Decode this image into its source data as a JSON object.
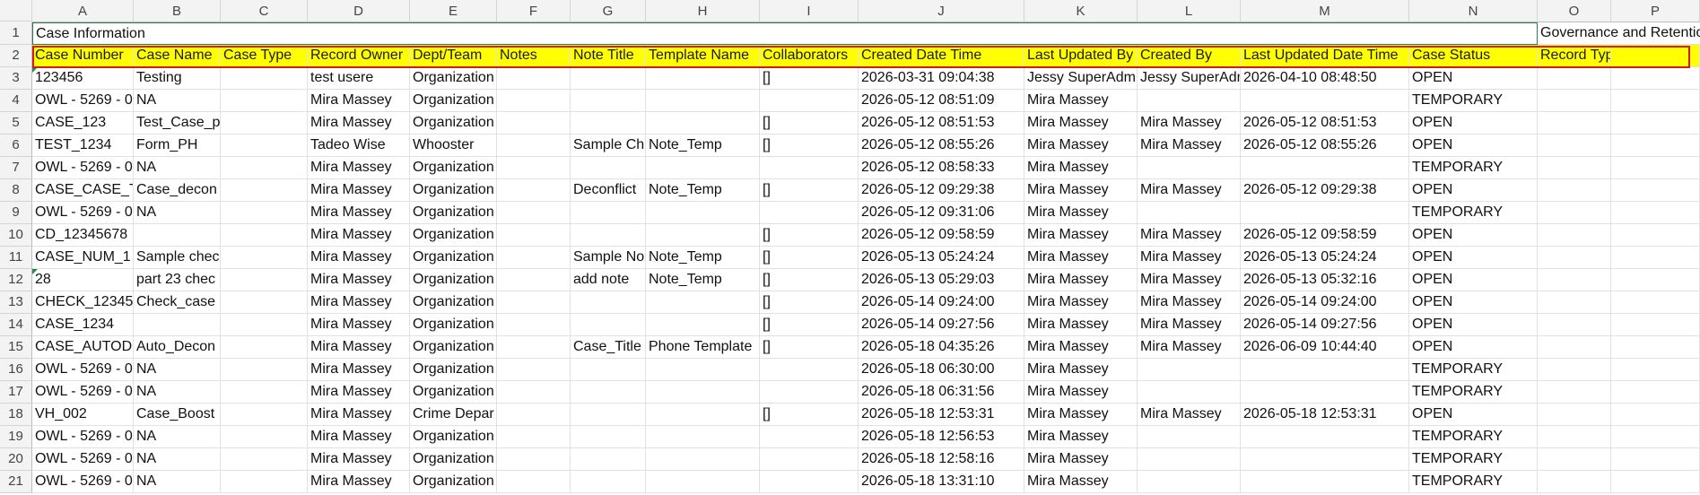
{
  "column_letters": [
    "A",
    "B",
    "C",
    "D",
    "E",
    "F",
    "G",
    "H",
    "I",
    "J",
    "K",
    "L",
    "M",
    "N",
    "O",
    "P"
  ],
  "row1": {
    "case_info": "Case Information",
    "governance": "Governance and Retention"
  },
  "headers": [
    "Case Number",
    "Case Name",
    "Case Type",
    "Record Owner",
    "Dept/Team",
    "Notes",
    "Note Title",
    "Template Name",
    "Collaborators",
    "Created Date Time",
    "Last Updated By",
    "Created By",
    "Last Updated Date Time",
    "Case Status",
    "Record Type",
    ""
  ],
  "rows": [
    {
      "n": "3",
      "c": [
        "123456",
        "Testing",
        "",
        "test usere",
        "Organization",
        "",
        "",
        "",
        "[]",
        "2026-03-31 09:04:38",
        "Jessy  SuperAdmin",
        "Jessy SuperAdmin",
        "2026-04-10 08:48:50",
        "OPEN",
        "",
        ""
      ]
    },
    {
      "n": "4",
      "c": [
        "OWL - 5269 - 0",
        "NA",
        "",
        "Mira Massey",
        "Organization",
        "",
        "",
        "",
        "",
        "2026-05-12 08:51:09",
        "Mira Massey",
        "",
        "",
        "TEMPORARY",
        "",
        ""
      ]
    },
    {
      "n": "5",
      "c": [
        "CASE_123",
        "Test_Case_p",
        "",
        "Mira Massey",
        "Organization",
        "",
        "",
        "",
        "[]",
        "2026-05-12 08:51:53",
        "Mira Massey",
        "Mira Massey",
        "2026-05-12 08:51:53",
        "OPEN",
        "",
        ""
      ]
    },
    {
      "n": "6",
      "c": [
        "TEST_1234",
        "Form_PH",
        "",
        "Tadeo Wise",
        "Whooster",
        "",
        "Sample Ch",
        "Note_Temp",
        "[]",
        "2026-05-12 08:55:26",
        "Mira Massey",
        "Mira Massey",
        "2026-05-12 08:55:26",
        "OPEN",
        "",
        ""
      ]
    },
    {
      "n": "7",
      "c": [
        "OWL - 5269 - 0",
        "NA",
        "",
        "Mira Massey",
        "Organization",
        "",
        "",
        "",
        "",
        "2026-05-12 08:58:33",
        "Mira Massey",
        "",
        "",
        "TEMPORARY",
        "",
        ""
      ]
    },
    {
      "n": "8",
      "c": [
        "CASE_CASE_T",
        "Case_decon",
        "",
        "Mira Massey",
        "Organization",
        "",
        "Deconflict",
        "Note_Temp",
        "[]",
        "2026-05-12 09:29:38",
        "Mira Massey",
        "Mira Massey",
        "2026-05-12 09:29:38",
        "OPEN",
        "",
        ""
      ]
    },
    {
      "n": "9",
      "c": [
        "OWL - 5269 - 0",
        "NA",
        "",
        "Mira Massey",
        "Organization",
        "",
        "",
        "",
        "",
        "2026-05-12 09:31:06",
        "Mira Massey",
        "",
        "",
        "TEMPORARY",
        "",
        ""
      ]
    },
    {
      "n": "10",
      "c": [
        "CD_12345678",
        "",
        "",
        "Mira Massey",
        "Organization",
        "",
        "",
        "",
        "[]",
        "2026-05-12 09:58:59",
        "Mira Massey",
        "Mira Massey",
        "2026-05-12 09:58:59",
        "OPEN",
        "",
        ""
      ]
    },
    {
      "n": "11",
      "c": [
        "CASE_NUM_1",
        "Sample chec",
        "",
        "Mira Massey",
        "Organization",
        "",
        "Sample No",
        "Note_Temp",
        "[]",
        "2026-05-13 05:24:24",
        "Mira Massey",
        "Mira Massey",
        "2026-05-13 05:24:24",
        "OPEN",
        "",
        ""
      ]
    },
    {
      "n": "12",
      "c": [
        "28",
        "part 23 chec",
        "",
        "Mira Massey",
        "Organization",
        "",
        "add note",
        "Note_Temp",
        "[]",
        "2026-05-13 05:29:03",
        "Mira Massey",
        "Mira Massey",
        "2026-05-13 05:32:16",
        "OPEN",
        "",
        ""
      ]
    },
    {
      "n": "13",
      "c": [
        "CHECK_12345",
        "Check_case",
        "",
        "Mira Massey",
        "Organization",
        "",
        "",
        "",
        "[]",
        "2026-05-14 09:24:00",
        "Mira Massey",
        "Mira Massey",
        "2026-05-14 09:24:00",
        "OPEN",
        "",
        ""
      ]
    },
    {
      "n": "14",
      "c": [
        "CASE_1234",
        "",
        "",
        "Mira Massey",
        "Organization",
        "",
        "",
        "",
        "[]",
        "2026-05-14 09:27:56",
        "Mira Massey",
        "Mira Massey",
        "2026-05-14 09:27:56",
        "OPEN",
        "",
        ""
      ]
    },
    {
      "n": "15",
      "c": [
        "CASE_AUTODI",
        "Auto_Decon",
        "",
        "Mira Massey",
        "Organization",
        "",
        "Case_Title",
        "Phone Template",
        "[]",
        "2026-05-18 04:35:26",
        "Mira Massey",
        "Mira Massey",
        "2026-06-09 10:44:40",
        "OPEN",
        "",
        ""
      ]
    },
    {
      "n": "16",
      "c": [
        "OWL - 5269 - 0",
        "NA",
        "",
        "Mira Massey",
        "Organization",
        "",
        "",
        "",
        "",
        "2026-05-18 06:30:00",
        "Mira Massey",
        "",
        "",
        "TEMPORARY",
        "",
        ""
      ]
    },
    {
      "n": "17",
      "c": [
        "OWL - 5269 - 0",
        "NA",
        "",
        "Mira Massey",
        "Organization",
        "",
        "",
        "",
        "",
        "2026-05-18 06:31:56",
        "Mira Massey",
        "",
        "",
        "TEMPORARY",
        "",
        ""
      ]
    },
    {
      "n": "18",
      "c": [
        "VH_002",
        "Case_Boost",
        "",
        "Mira Massey",
        "Crime Depar",
        "",
        "",
        "",
        "[]",
        "2026-05-18 12:53:31",
        "Mira Massey",
        "Mira Massey",
        "2026-05-18 12:53:31",
        "OPEN",
        "",
        ""
      ]
    },
    {
      "n": "19",
      "c": [
        "OWL - 5269 - 0",
        "NA",
        "",
        "Mira Massey",
        "Organization",
        "",
        "",
        "",
        "",
        "2026-05-18 12:56:53",
        "Mira Massey",
        "",
        "",
        "TEMPORARY",
        "",
        ""
      ]
    },
    {
      "n": "20",
      "c": [
        "OWL - 5269 - 0",
        "NA",
        "",
        "Mira Massey",
        "Organization",
        "",
        "",
        "",
        "",
        "2026-05-18 12:58:16",
        "Mira Massey",
        "",
        "",
        "TEMPORARY",
        "",
        ""
      ]
    },
    {
      "n": "21",
      "c": [
        "OWL - 5269 - 0",
        "NA",
        "",
        "Mira Massey",
        "Organization",
        "",
        "",
        "",
        "",
        "2026-05-18 13:31:10",
        "Mira Massey",
        "",
        "",
        "TEMPORARY",
        "",
        ""
      ]
    }
  ],
  "colors": {
    "header_fill": "#ffff00",
    "highlight_border": "#d11a1a",
    "row1_border": "#2e7d4f"
  }
}
